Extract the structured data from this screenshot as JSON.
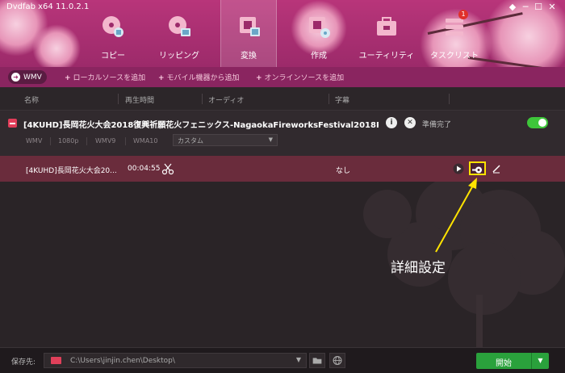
{
  "app": {
    "title": "Dvdfab x64 11.0.2.1"
  },
  "window_controls": [
    "◆",
    "─",
    "☐",
    "✕"
  ],
  "tabs": [
    {
      "label": "コピー",
      "icon": "disc-copy-icon"
    },
    {
      "label": "リッピング",
      "icon": "disc-rip-icon"
    },
    {
      "label": "変換",
      "icon": "film-convert-icon",
      "active": true
    },
    {
      "label": "作成",
      "icon": "film-create-icon"
    },
    {
      "label": "ユーティリティ",
      "icon": "toolbox-icon"
    },
    {
      "label": "タスクリスト",
      "icon": "task-list-icon",
      "badge": "1"
    }
  ],
  "toolbar": {
    "format": "WMV",
    "add_local": "ローカルソースを追加",
    "add_mobile": "モバイル機器から追加",
    "add_online": "オンラインソースを追加"
  },
  "columns": {
    "name": "名称",
    "duration": "再生時間",
    "audio": "オーディオ",
    "subtitle": "字幕"
  },
  "file": {
    "title": "[4KUHD]長岡花火大会2018復興祈願花火フェニックス-NagaokaFireworksFestival2018Ph",
    "status": "準備完了",
    "params": [
      "WMV",
      "1080p",
      "WMV9",
      "WMA10"
    ],
    "profile": "カスタム"
  },
  "track": {
    "name": "[4KUHD]長岡花火大会20...",
    "duration": "00:04:55",
    "subtitle": "なし"
  },
  "annotation": "詳細設定",
  "bottom": {
    "save_label": "保存先:",
    "path": "C:\\Users\\jinjin.chen\\Desktop\\",
    "start": "開始"
  },
  "colors": {
    "accent": "#b8357a",
    "highlight": "#ffe300",
    "start": "#2aa13c"
  }
}
